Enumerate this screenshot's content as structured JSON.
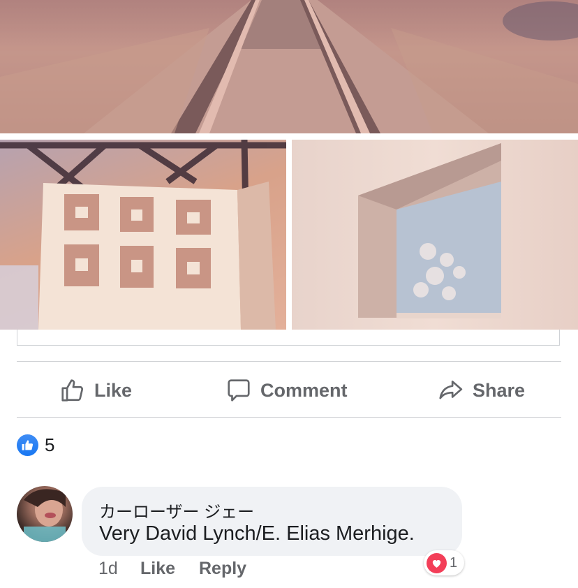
{
  "post": {
    "photos": [
      {
        "name": "railroad tracks"
      },
      {
        "name": "decorative concrete block wall"
      },
      {
        "name": "window in white wall"
      }
    ]
  },
  "actions": {
    "like_label": "Like",
    "comment_label": "Comment",
    "share_label": "Share"
  },
  "reactions": {
    "count": "5",
    "icon": "thumbs-up-icon",
    "color": "#1877f2"
  },
  "comment": {
    "author": "カーローザー ジェー",
    "text": "Very David Lynch/E. Elias Merhige.",
    "time": "1d",
    "like_label": "Like",
    "reply_label": "Reply",
    "reaction_count": "1",
    "reaction_icon": "heart-icon",
    "reaction_color": "#f33e58"
  }
}
